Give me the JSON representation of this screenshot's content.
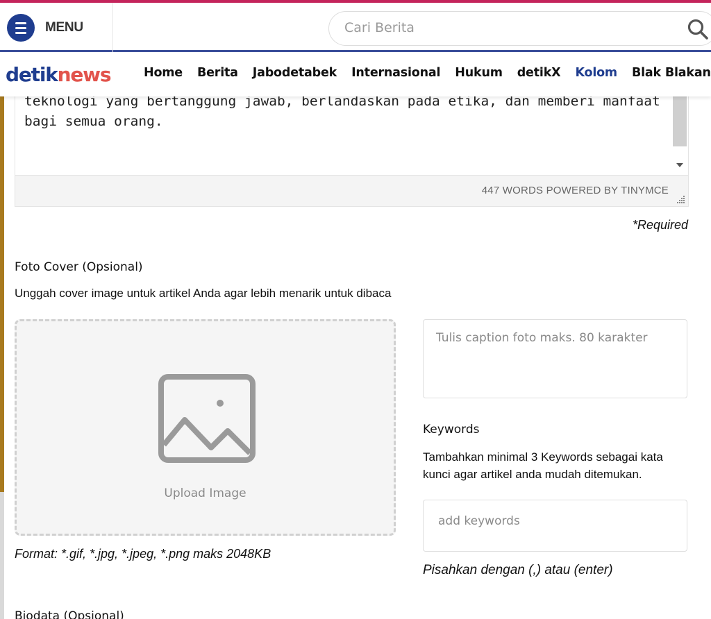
{
  "header": {
    "menu_label": "MENU",
    "search_placeholder": "Cari Berita"
  },
  "brand": {
    "logo_part1": "detik",
    "logo_part2": "news",
    "color_primary": "#1f3d8f",
    "color_accent": "#e2534b"
  },
  "nav": {
    "items": [
      {
        "label": "Home"
      },
      {
        "label": "Berita"
      },
      {
        "label": "Jabodetabek"
      },
      {
        "label": "Internasional"
      },
      {
        "label": "Hukum"
      },
      {
        "label": "detikX"
      },
      {
        "label": "Kolom"
      },
      {
        "label": "Blak Blakan"
      }
    ],
    "active": "Kolom"
  },
  "editor": {
    "text_line1": "teknologi yang bertanggung jawab, berlandaskan pada etika, dan memberi manfaat",
    "text_line2": "bagi semua orang.",
    "word_count": "447 WORDS POWERED BY TINYMCE"
  },
  "form": {
    "required_note": "*Required",
    "cover": {
      "title": "Foto Cover (Opsional)",
      "description": "Unggah cover image untuk artikel Anda agar lebih menarik untuk dibaca",
      "upload_label": "Upload Image",
      "format_note": "Format: *.gif, *.jpg, *.jpeg, *.png maks 2048KB",
      "caption_placeholder": "Tulis caption foto maks. 80 karakter"
    },
    "keywords": {
      "title": "Keywords",
      "description_line1": "Tambahkan minimal 3 Keywords sebagai kata",
      "description_line2": "kunci agar artikel anda mudah ditemukan.",
      "placeholder": "add keywords",
      "separator_note": "Pisahkan dengan (,) atau (enter)"
    },
    "next_section_title": "Biodata (Opsional)"
  }
}
